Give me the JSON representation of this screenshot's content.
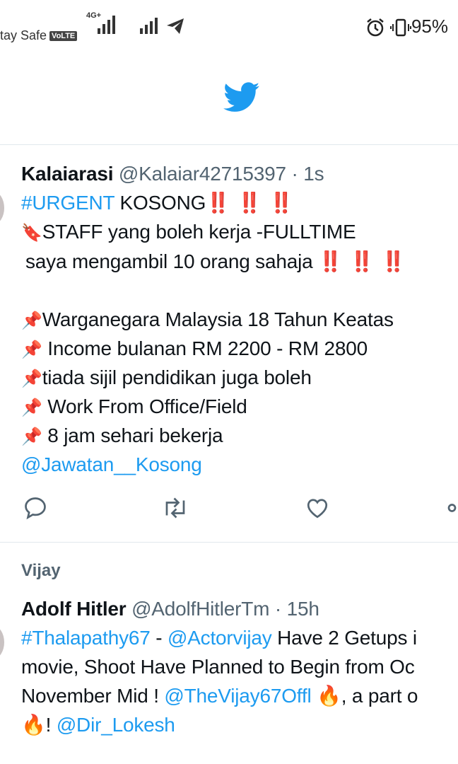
{
  "status_bar": {
    "carrier": "tay Safe",
    "volte": "VoLTE",
    "network": "4G+",
    "battery": "95%",
    "icons": [
      "signal-icon",
      "signal-icon",
      "telegram-icon",
      "alarm-icon",
      "vibrate-icon"
    ]
  },
  "header": {
    "logo": "twitter-bird-icon",
    "accent": "#1d9bf0"
  },
  "tweets": [
    {
      "name": "Kalaiarasi",
      "handle": "@Kalaiar42715397",
      "sep": "·",
      "time": "1s",
      "hashtag": "#URGENT",
      "l1_text": "KOSONG",
      "bangs": "‼️ ‼️ ‼️",
      "l2": "STAFF yang boleh kerja -FULLTIME",
      "l3": "saya mengambil 10 orang sahaja",
      "l3_bangs": "‼️ ‼️ ‼️",
      "bullets": [
        "Warganegara Malaysia 18 Tahun Keatas",
        " Income bulanan RM 2200 - RM 2800",
        "tiada sijil pendidikan juga boleh",
        " Work From Office/Field",
        " 8 jam sehari bekerja"
      ],
      "mention": "@Jawatan__Kosong",
      "actions": [
        "reply-icon",
        "retweet-icon",
        "like-icon",
        "share-icon"
      ]
    },
    {
      "context": "Vijay",
      "name": "Adolf Hitler",
      "handle": "@AdolfHitlerTm",
      "sep": "·",
      "time": "15h",
      "hashtag": "#Thalapathy67",
      "dash": " - ",
      "mention1": "@Actorvijay",
      "l1_rest": " Have 2 Getups i",
      "l2": "movie, Shoot Have Planned to Begin from Oc",
      "l3_start": "November Mid ! ",
      "mention2": "@TheVijay67Offl",
      "l3_end": " 🔥, a part o",
      "l4_start": "🔥! ",
      "mention3": "@Dir_Lokesh"
    }
  ]
}
